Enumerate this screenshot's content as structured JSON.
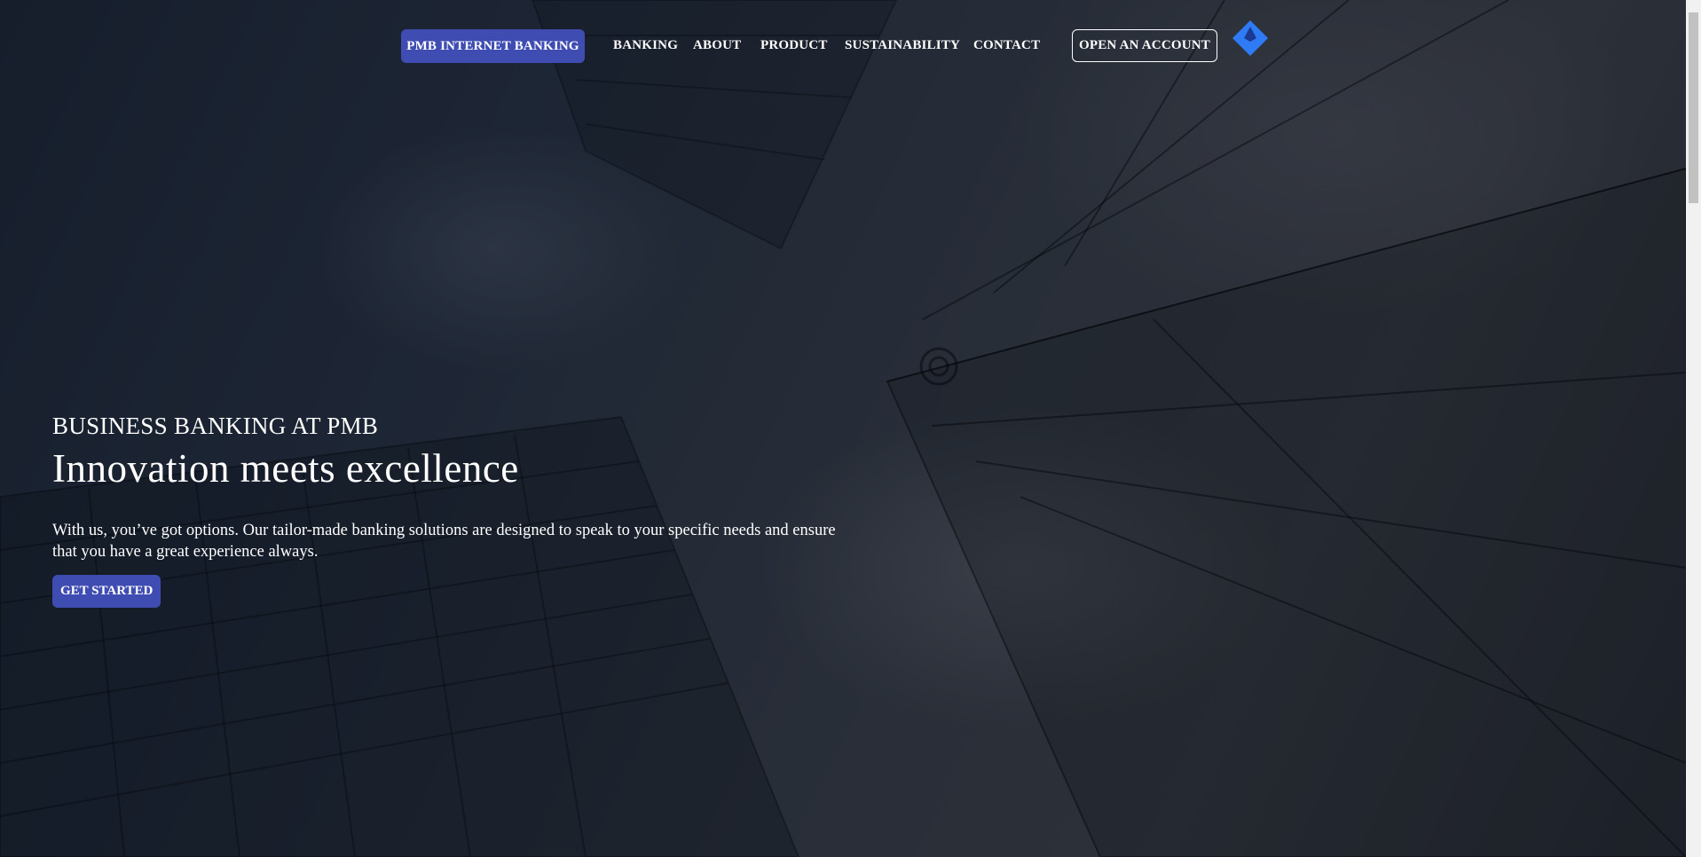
{
  "nav": {
    "internet_banking": "PMB INTERNET BANKING",
    "links": [
      "BANKING",
      "ABOUT",
      "PRODUCT",
      "SUSTAINABILITY",
      "CONTACT"
    ],
    "open_account": "OPEN AN ACCOUNT",
    "logo_icon": "diamond-logo-icon"
  },
  "hero": {
    "eyebrow": "BUSINESS BANKING AT PMB",
    "headline": "Innovation meets excellence",
    "description": "With us, you’ve got options. Our tailor-made banking solutions are designed to speak to your specific needs and ensure that you have a great experience always.",
    "cta": "GET STARTED"
  },
  "colors": {
    "accent": "#3f4db3",
    "logo": "#2f7bf5",
    "text": "#ffffff"
  }
}
